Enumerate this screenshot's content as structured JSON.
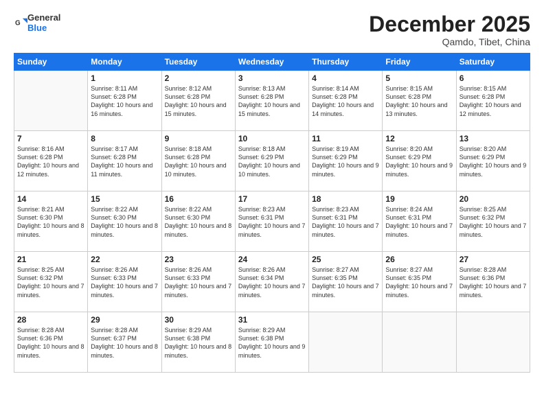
{
  "header": {
    "logo_general": "General",
    "logo_blue": "Blue",
    "title": "December 2025",
    "subtitle": "Qamdo, Tibet, China"
  },
  "weekdays": [
    "Sunday",
    "Monday",
    "Tuesday",
    "Wednesday",
    "Thursday",
    "Friday",
    "Saturday"
  ],
  "weeks": [
    [
      {
        "day": "",
        "info": ""
      },
      {
        "day": "1",
        "info": "Sunrise: 8:11 AM\nSunset: 6:28 PM\nDaylight: 10 hours\nand 16 minutes."
      },
      {
        "day": "2",
        "info": "Sunrise: 8:12 AM\nSunset: 6:28 PM\nDaylight: 10 hours\nand 15 minutes."
      },
      {
        "day": "3",
        "info": "Sunrise: 8:13 AM\nSunset: 6:28 PM\nDaylight: 10 hours\nand 15 minutes."
      },
      {
        "day": "4",
        "info": "Sunrise: 8:14 AM\nSunset: 6:28 PM\nDaylight: 10 hours\nand 14 minutes."
      },
      {
        "day": "5",
        "info": "Sunrise: 8:15 AM\nSunset: 6:28 PM\nDaylight: 10 hours\nand 13 minutes."
      },
      {
        "day": "6",
        "info": "Sunrise: 8:15 AM\nSunset: 6:28 PM\nDaylight: 10 hours\nand 12 minutes."
      }
    ],
    [
      {
        "day": "7",
        "info": "Sunrise: 8:16 AM\nSunset: 6:28 PM\nDaylight: 10 hours\nand 12 minutes."
      },
      {
        "day": "8",
        "info": "Sunrise: 8:17 AM\nSunset: 6:28 PM\nDaylight: 10 hours\nand 11 minutes."
      },
      {
        "day": "9",
        "info": "Sunrise: 8:18 AM\nSunset: 6:28 PM\nDaylight: 10 hours\nand 10 minutes."
      },
      {
        "day": "10",
        "info": "Sunrise: 8:18 AM\nSunset: 6:29 PM\nDaylight: 10 hours\nand 10 minutes."
      },
      {
        "day": "11",
        "info": "Sunrise: 8:19 AM\nSunset: 6:29 PM\nDaylight: 10 hours\nand 9 minutes."
      },
      {
        "day": "12",
        "info": "Sunrise: 8:20 AM\nSunset: 6:29 PM\nDaylight: 10 hours\nand 9 minutes."
      },
      {
        "day": "13",
        "info": "Sunrise: 8:20 AM\nSunset: 6:29 PM\nDaylight: 10 hours\nand 9 minutes."
      }
    ],
    [
      {
        "day": "14",
        "info": "Sunrise: 8:21 AM\nSunset: 6:30 PM\nDaylight: 10 hours\nand 8 minutes."
      },
      {
        "day": "15",
        "info": "Sunrise: 8:22 AM\nSunset: 6:30 PM\nDaylight: 10 hours\nand 8 minutes."
      },
      {
        "day": "16",
        "info": "Sunrise: 8:22 AM\nSunset: 6:30 PM\nDaylight: 10 hours\nand 8 minutes."
      },
      {
        "day": "17",
        "info": "Sunrise: 8:23 AM\nSunset: 6:31 PM\nDaylight: 10 hours\nand 7 minutes."
      },
      {
        "day": "18",
        "info": "Sunrise: 8:23 AM\nSunset: 6:31 PM\nDaylight: 10 hours\nand 7 minutes."
      },
      {
        "day": "19",
        "info": "Sunrise: 8:24 AM\nSunset: 6:31 PM\nDaylight: 10 hours\nand 7 minutes."
      },
      {
        "day": "20",
        "info": "Sunrise: 8:25 AM\nSunset: 6:32 PM\nDaylight: 10 hours\nand 7 minutes."
      }
    ],
    [
      {
        "day": "21",
        "info": "Sunrise: 8:25 AM\nSunset: 6:32 PM\nDaylight: 10 hours\nand 7 minutes."
      },
      {
        "day": "22",
        "info": "Sunrise: 8:26 AM\nSunset: 6:33 PM\nDaylight: 10 hours\nand 7 minutes."
      },
      {
        "day": "23",
        "info": "Sunrise: 8:26 AM\nSunset: 6:33 PM\nDaylight: 10 hours\nand 7 minutes."
      },
      {
        "day": "24",
        "info": "Sunrise: 8:26 AM\nSunset: 6:34 PM\nDaylight: 10 hours\nand 7 minutes."
      },
      {
        "day": "25",
        "info": "Sunrise: 8:27 AM\nSunset: 6:35 PM\nDaylight: 10 hours\nand 7 minutes."
      },
      {
        "day": "26",
        "info": "Sunrise: 8:27 AM\nSunset: 6:35 PM\nDaylight: 10 hours\nand 7 minutes."
      },
      {
        "day": "27",
        "info": "Sunrise: 8:28 AM\nSunset: 6:36 PM\nDaylight: 10 hours\nand 7 minutes."
      }
    ],
    [
      {
        "day": "28",
        "info": "Sunrise: 8:28 AM\nSunset: 6:36 PM\nDaylight: 10 hours\nand 8 minutes."
      },
      {
        "day": "29",
        "info": "Sunrise: 8:28 AM\nSunset: 6:37 PM\nDaylight: 10 hours\nand 8 minutes."
      },
      {
        "day": "30",
        "info": "Sunrise: 8:29 AM\nSunset: 6:38 PM\nDaylight: 10 hours\nand 8 minutes."
      },
      {
        "day": "31",
        "info": "Sunrise: 8:29 AM\nSunset: 6:38 PM\nDaylight: 10 hours\nand 9 minutes."
      },
      {
        "day": "",
        "info": ""
      },
      {
        "day": "",
        "info": ""
      },
      {
        "day": "",
        "info": ""
      }
    ]
  ]
}
